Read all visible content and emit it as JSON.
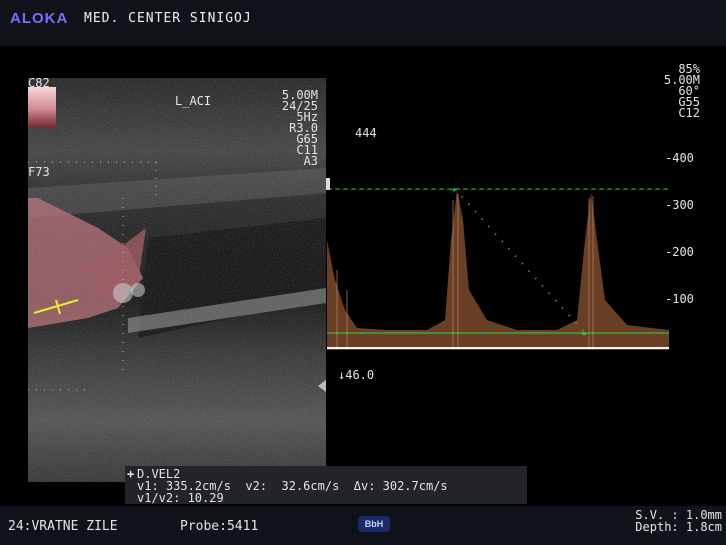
{
  "header": {
    "brand": "ALOKA",
    "clinic": "MED. CENTER SINIGOJ"
  },
  "bmode": {
    "gain_label": "C82",
    "focus_label": "F73",
    "vessel_label": "L_ACI",
    "params": [
      "5.00M",
      "24/25",
      "5Hz",
      "R3.0",
      "G65",
      "C11",
      "A3"
    ]
  },
  "doppler": {
    "params": [
      "85%",
      "5.00M",
      "60°",
      "G55",
      "C12"
    ],
    "prf_label": "444",
    "baseline_label": "↓46.0",
    "scale_ticks": [
      "-400",
      "-300",
      "-200",
      "-100"
    ]
  },
  "measurement": {
    "title": "D.VEL2",
    "line1": "v1: 335.2cm/s  v2:  32.6cm/s  Δv: 302.7cm/s",
    "line2": "v1/v2: 10.29"
  },
  "footer": {
    "exam": "24:VRATNE ZILE",
    "probe": "Probe:5411",
    "badge": "BbH",
    "sv": "S.V. : 1.0mm",
    "depth": "Depth: 1.8cm"
  },
  "colors": {
    "brand": "#7a6cff",
    "cursor_green": "#35d04a",
    "flow_red": "#b86a72"
  },
  "icons": {
    "measure": "cross-icon",
    "scroll": "triangle-left-icon"
  }
}
